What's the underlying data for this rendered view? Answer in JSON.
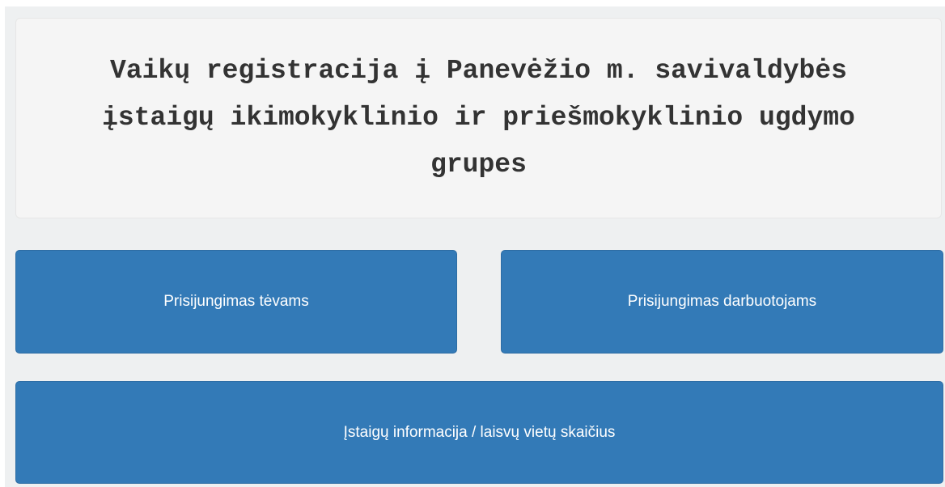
{
  "header": {
    "title": "Vaikų registracija į Panevėžio m. savivaldybės įstaigų ikimokyklinio ir priešmokyklinio ugdymo grupes"
  },
  "buttons": {
    "parents_login": "Prisijungimas tėvams",
    "staff_login": "Prisijungimas darbuotojams",
    "institutions_info": "Įstaigų informacija / laisvų vietų skaičius"
  },
  "colors": {
    "button_bg": "#337ab7",
    "button_text": "#ffffff",
    "panel_bg": "#f5f5f5",
    "page_bg": "#eef0f1",
    "title_text": "#333333"
  }
}
